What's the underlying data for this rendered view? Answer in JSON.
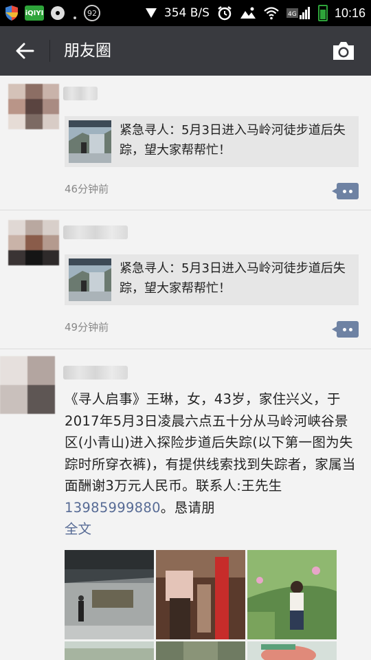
{
  "status_bar": {
    "net_speed": "354 B/S",
    "network": "4G",
    "time": "10:16",
    "badge": "92",
    "app_badge": "iQIYI"
  },
  "header": {
    "title": "朋友圈"
  },
  "posts": [
    {
      "share_text": "紧急寻人：5月3日进入马岭河徒步道后失踪，望大家帮帮忙！",
      "time": "46分钟前"
    },
    {
      "share_text": "紧急寻人：5月3日进入马岭河徒步道后失踪，望大家帮帮忙！",
      "time": "49分钟前"
    },
    {
      "text_before_phone": "《寻人启事》王琳，女，43岁，家住兴义，于2017年5月3日凌晨六点五十分从马岭河峡谷景区(小青山)进入探险步道后失踪(以下第一图为失踪时所穿衣裤)，有提供线索找到失踪者，家属当面酬谢3万元人民币。联系人:王先生",
      "phone": "13985999880",
      "text_after_phone": "。恳请朋",
      "full_text_link": "全文"
    }
  ],
  "colors": {
    "header_bg": "#393a3f",
    "link": "#576b95",
    "card_bg": "#e6e6e6"
  }
}
